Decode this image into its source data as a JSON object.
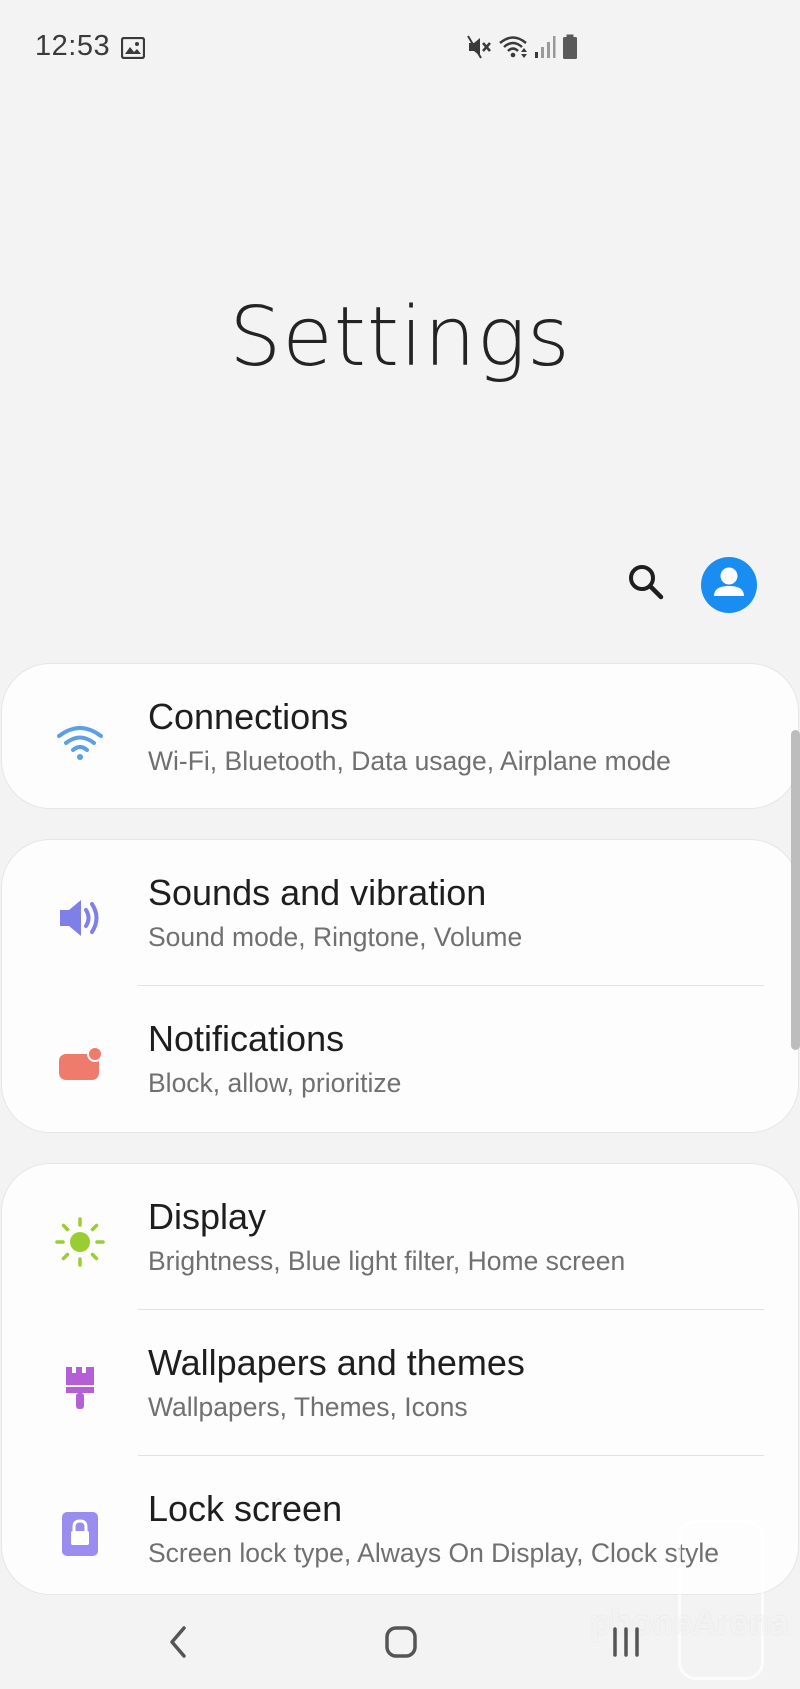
{
  "status_bar": {
    "time": "12:53",
    "icons": [
      "gallery-icon",
      "mute-icon",
      "wifi-icon",
      "signal-icon",
      "battery-icon"
    ]
  },
  "header": {
    "title": "Settings"
  },
  "toolbar": {
    "search_icon": "search-icon",
    "account_icon": "account-icon",
    "account_color": "#1a8df3"
  },
  "groups": [
    {
      "items": [
        {
          "title": "Connections",
          "subtitle": "Wi-Fi, Bluetooth, Data usage, Airplane mode",
          "icon": "wifi-icon",
          "color": "#5aa0e6"
        }
      ]
    },
    {
      "items": [
        {
          "title": "Sounds and vibration",
          "subtitle": "Sound mode, Ringtone, Volume",
          "icon": "speaker-icon",
          "color": "#7f7fe8"
        },
        {
          "title": "Notifications",
          "subtitle": "Block, allow, prioritize",
          "icon": "notification-icon",
          "color": "#ef7b6d"
        }
      ]
    },
    {
      "items": [
        {
          "title": "Display",
          "subtitle": "Brightness, Blue light filter, Home screen",
          "icon": "sun-icon",
          "color": "#9acd32"
        },
        {
          "title": "Wallpapers and themes",
          "subtitle": "Wallpapers, Themes, Icons",
          "icon": "brush-icon",
          "color": "#b45fd6"
        },
        {
          "title": "Lock screen",
          "subtitle": "Screen lock type, Always On Display, Clock style",
          "icon": "lock-icon",
          "color": "#9b8cf0"
        }
      ]
    }
  ],
  "watermark": "phoneArena",
  "nav": {
    "back": "back-icon",
    "home": "home-icon",
    "recent": "recent-apps-icon"
  }
}
